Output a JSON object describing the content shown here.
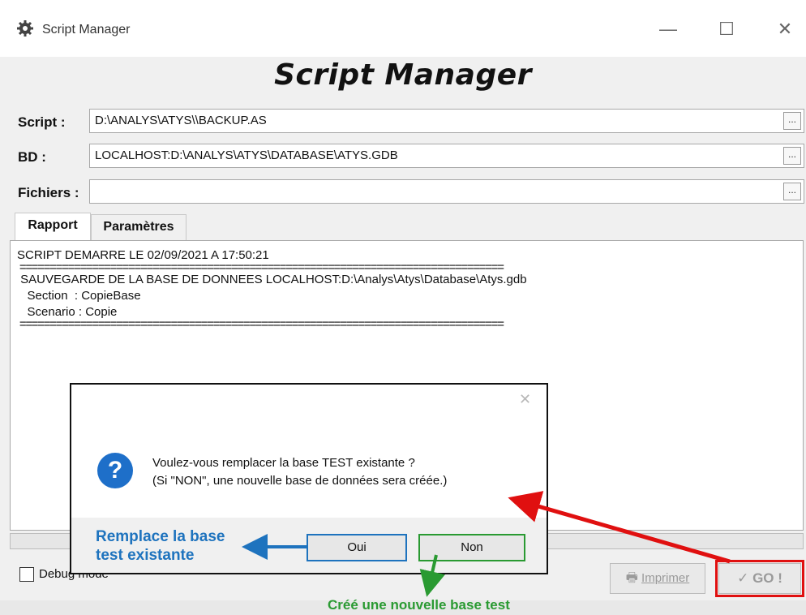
{
  "window": {
    "title": "Script Manager",
    "app_heading": "Script Manager",
    "minimize_glyph": "—",
    "maximize_glyph": "☐",
    "close_glyph": "✕"
  },
  "form": {
    "script_label": "Script :",
    "script_value": "D:\\ANALYS\\ATYS\\\\BACKUP.AS",
    "bd_label": "BD :",
    "bd_value": "LOCALHOST:D:\\ANALYS\\ATYS\\DATABASE\\ATYS.GDB",
    "fichiers_label": "Fichiers :",
    "fichiers_value": "",
    "browse_label": "..."
  },
  "tabs": [
    {
      "label": "Rapport"
    },
    {
      "label": "Paramètres"
    }
  ],
  "report": {
    "lines": [
      "SCRIPT DEMARRE LE 02/09/2021 A 17:50:21",
      " ================================================================================",
      " SAUVEGARDE DE LA BASE DE DONNEES LOCALHOST:D:\\Analys\\Atys\\Database\\Atys.gdb",
      "   Section  : CopieBase",
      "   Scenario : Copie",
      " ================================================================================"
    ]
  },
  "footer": {
    "debug_label": "Debug mode",
    "print_label": "Imprimer",
    "go_label": "GO !"
  },
  "dialog": {
    "close_glyph": "✕",
    "icon_glyph": "?",
    "message_line1": "Voulez-vous remplacer la base TEST existante ?",
    "message_line2": "(Si \"NON\", une nouvelle  base de données sera créée.)",
    "oui_label": "Oui",
    "non_label": "Non"
  },
  "annotations": {
    "remplace_line1": "Remplace la base",
    "remplace_line2": "test existante",
    "cree_label": "Créé une nouvelle base test",
    "colors": {
      "red": "#e01010",
      "blue": "#1e73be",
      "green": "#2a9a32"
    }
  }
}
